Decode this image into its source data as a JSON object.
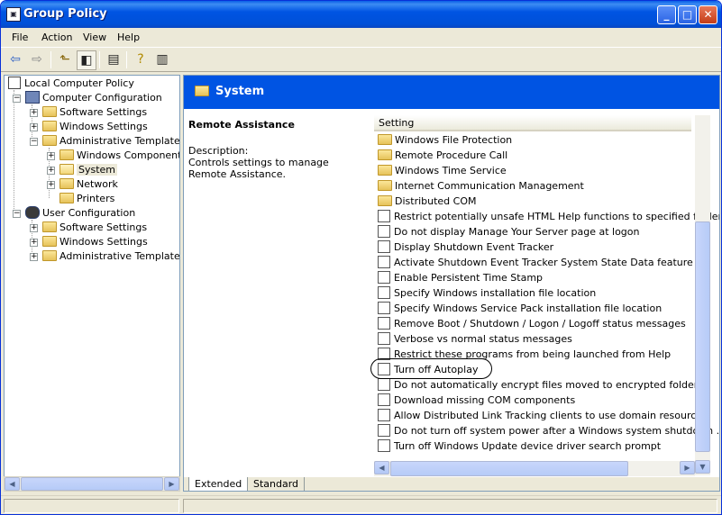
{
  "window": {
    "title": "Group Policy"
  },
  "menu": {
    "file": "File",
    "action": "Action",
    "view": "View",
    "help": "Help"
  },
  "toolbar": {
    "icons": [
      "back-arrow-icon",
      "forward-arrow-icon",
      "up-folder-icon",
      "show-hide-tree-icon",
      "export-list-icon",
      "help-icon",
      "properties-icon"
    ]
  },
  "tree": {
    "root": "Local Computer Policy",
    "computer": "Computer Configuration",
    "cc_software": "Software Settings",
    "cc_windows": "Windows Settings",
    "cc_admin": "Administrative Templates",
    "cc_admin_wincomp": "Windows Components",
    "cc_admin_system": "System",
    "cc_admin_network": "Network",
    "cc_admin_printers": "Printers",
    "user": "User Configuration",
    "uc_software": "Software Settings",
    "uc_windows": "Windows Settings",
    "uc_admin": "Administrative Templates"
  },
  "right": {
    "header": "System",
    "desc_title": "Remote Assistance",
    "desc_label": "Description:",
    "desc_text": "Controls settings to manage Remote Assistance.",
    "column": "Setting",
    "items": [
      {
        "label": "Windows File Protection",
        "kind": "folder"
      },
      {
        "label": "Remote Procedure Call",
        "kind": "folder"
      },
      {
        "label": "Windows Time Service",
        "kind": "folder"
      },
      {
        "label": "Internet Communication Management",
        "kind": "folder"
      },
      {
        "label": "Distributed COM",
        "kind": "folder"
      },
      {
        "label": "Restrict potentially unsafe HTML Help functions to specified folders",
        "kind": "policy"
      },
      {
        "label": "Do not display Manage Your Server page at logon",
        "kind": "policy"
      },
      {
        "label": "Display Shutdown Event Tracker",
        "kind": "policy"
      },
      {
        "label": "Activate Shutdown Event Tracker System State Data feature",
        "kind": "policy"
      },
      {
        "label": "Enable Persistent Time Stamp",
        "kind": "policy"
      },
      {
        "label": "Specify Windows installation file location",
        "kind": "policy"
      },
      {
        "label": "Specify Windows Service Pack installation file location",
        "kind": "policy"
      },
      {
        "label": "Remove Boot / Shutdown / Logon / Logoff status messages",
        "kind": "policy"
      },
      {
        "label": "Verbose vs normal status messages",
        "kind": "policy"
      },
      {
        "label": "Restrict these programs from being launched from Help",
        "kind": "policy"
      },
      {
        "label": "Turn off Autoplay",
        "kind": "policy"
      },
      {
        "label": "Do not automatically encrypt files moved to encrypted folders",
        "kind": "policy"
      },
      {
        "label": "Download missing COM components",
        "kind": "policy"
      },
      {
        "label": "Allow Distributed Link Tracking clients to use domain resources",
        "kind": "policy"
      },
      {
        "label": "Do not turn off system power after a Windows system shutdown ...",
        "kind": "policy"
      },
      {
        "label": "Turn off Windows Update device driver search prompt",
        "kind": "policy"
      }
    ],
    "tabs": {
      "extended": "Extended",
      "standard": "Standard"
    }
  },
  "colors": {
    "accent": "#0054e3",
    "chrome": "#ece9d8"
  }
}
